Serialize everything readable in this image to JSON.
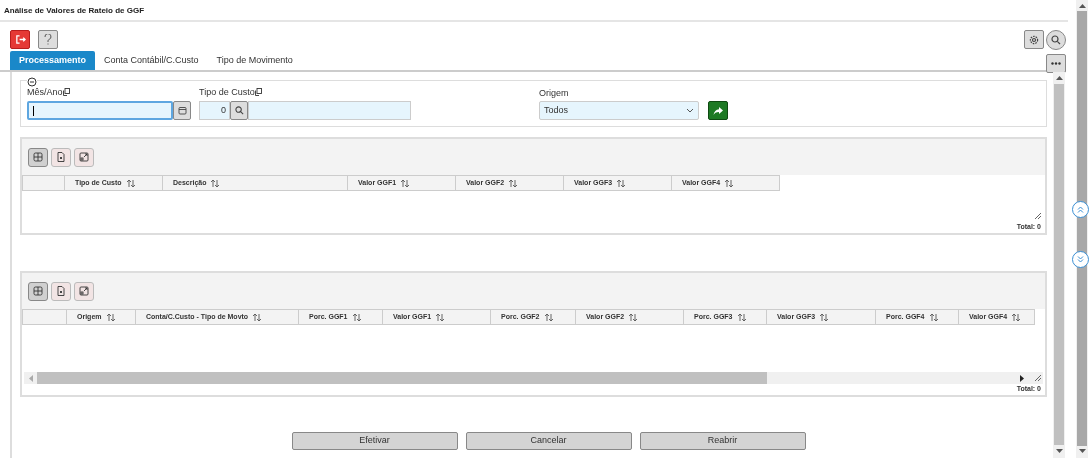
{
  "window": {
    "title": "Análise de Valores de Rateio de GGF"
  },
  "tabs": [
    {
      "label": "Processamento",
      "selected": true
    },
    {
      "label": "Conta Contábil/C.Custo",
      "selected": false
    },
    {
      "label": "Tipo de Movimento",
      "selected": false
    }
  ],
  "form": {
    "mes_ano": {
      "label": "Mês/Ano"
    },
    "tipo_de_custo": {
      "label": "Tipo de Custo",
      "value": "0"
    },
    "origem": {
      "label": "Origem",
      "value": "Todos"
    }
  },
  "grids": [
    {
      "columns": [
        "Tipo de Custo",
        "Descrição",
        "Valor GGF1",
        "Valor GGF2",
        "Valor GGF3",
        "Valor GGF4"
      ],
      "total": "Total: 0",
      "h_scroll": false
    },
    {
      "columns": [
        "Origem",
        "Conta/C.Custo - Tipo de Movto",
        "Porc. GGF1",
        "Valor GGF1",
        "Porc. GGF2",
        "Valor GGF2",
        "Porc. GGF3",
        "Valor GGF3",
        "Porc. GGF4",
        "Valor GGF4"
      ],
      "total": "Total: 0",
      "h_scroll": true
    }
  ],
  "buttons": [
    "Efetivar",
    "Cancelar",
    "Reabrir"
  ]
}
